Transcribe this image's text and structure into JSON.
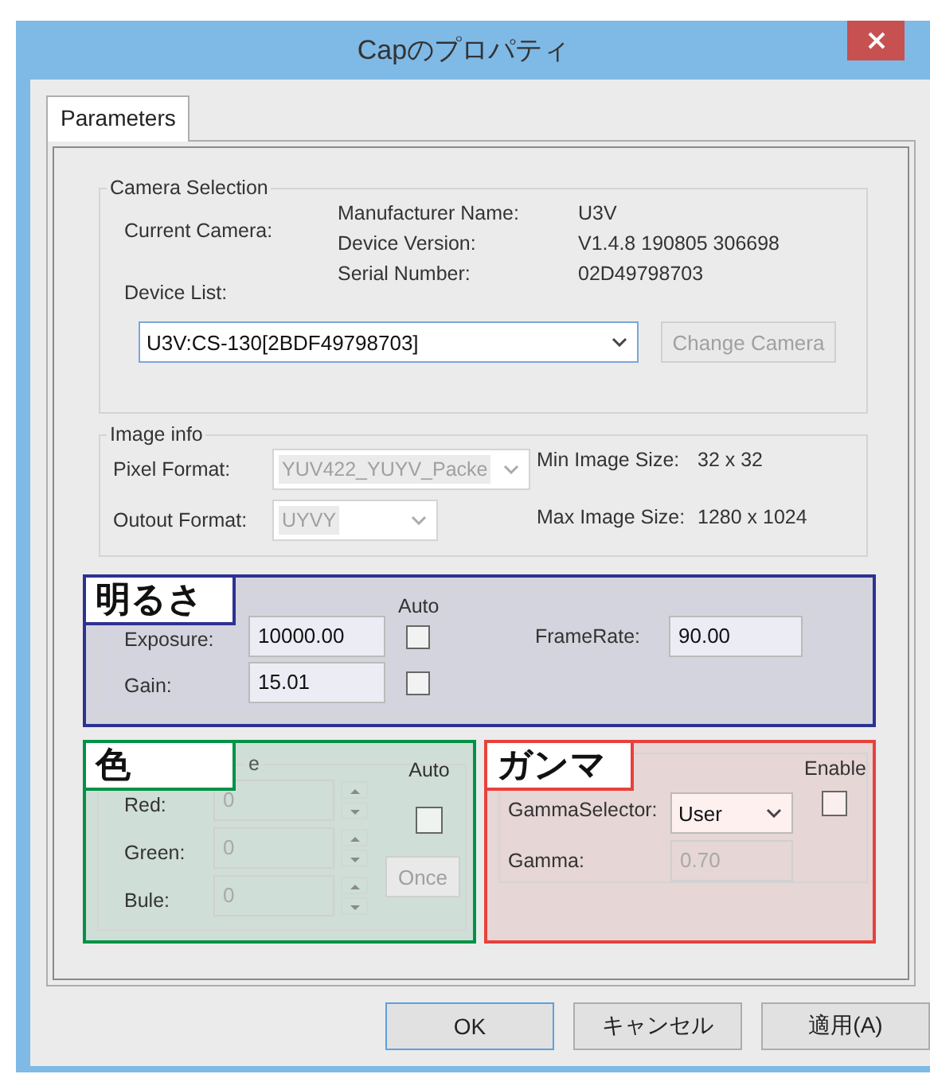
{
  "window": {
    "title": "Capのプロパティ"
  },
  "tabs": [
    {
      "label": "Parameters",
      "selected": true
    }
  ],
  "camera_selection": {
    "title": "Camera Selection",
    "current_camera_label": "Current Camera:",
    "device_list_label": "Device List:",
    "info": [
      {
        "label": "Manufacturer Name:",
        "value": "U3V"
      },
      {
        "label": "Device Version:",
        "value": "V1.4.8 190805 306698"
      },
      {
        "label": "Serial Number:",
        "value": "02D49798703"
      }
    ],
    "device": {
      "value": "U3V:CS-130[2BDF49798703]"
    },
    "change_camera": {
      "label": "Change Camera",
      "disabled": true
    }
  },
  "image_info": {
    "title": "Image info",
    "formats": [
      {
        "label": "Pixel Format:",
        "value": "YUV422_YUYV_Packe",
        "disabled": true
      },
      {
        "label": "Outout Format:",
        "value": "UYVY",
        "disabled": true
      }
    ],
    "sizes": [
      {
        "label": "Min Image Size:",
        "value": "32 x 32"
      },
      {
        "label": "Max Image Size:",
        "value": "1280 x 1024"
      }
    ]
  },
  "annotations": [
    {
      "label": "明るさ",
      "color": "#2e3192"
    },
    {
      "label": "色",
      "color": "#009245"
    },
    {
      "label": "ガンマ",
      "color": "#e8413c"
    }
  ],
  "brightness": {
    "auto_header": "Auto",
    "rows": [
      {
        "label": "Exposure:",
        "value": "10000.00",
        "auto_checked": false
      },
      {
        "label": "Gain:",
        "value": "15.01",
        "auto_checked": false
      }
    ],
    "frame_rate": {
      "label": "FrameRate:",
      "value": "90.00"
    }
  },
  "white_balance": {
    "title_fragment": "e",
    "auto_header": "Auto",
    "auto_checked": false,
    "disabled": true,
    "channels": [
      {
        "label": "Red:",
        "value": "0"
      },
      {
        "label": "Green:",
        "value": "0"
      },
      {
        "label": "Bule:",
        "value": "0"
      }
    ],
    "once": {
      "label": "Once",
      "disabled": true
    }
  },
  "gamma": {
    "enable_header": "Enable",
    "enable_checked": false,
    "selector": {
      "label": "GammaSelector:",
      "value": "User"
    },
    "gamma": {
      "label": "Gamma:",
      "value": "0.70",
      "disabled": true
    }
  },
  "buttons": [
    {
      "label": "OK",
      "default": true
    },
    {
      "label": "キャンセル",
      "default": false
    },
    {
      "label": "適用(A)",
      "default": false
    }
  ]
}
